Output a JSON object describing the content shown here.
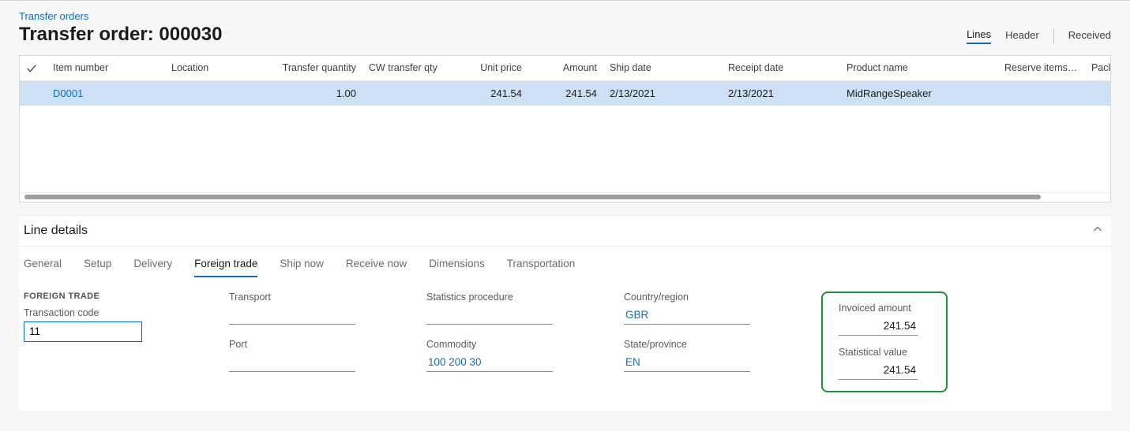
{
  "breadcrumb": {
    "transfer_orders": "Transfer orders"
  },
  "title": "Transfer order: 000030",
  "view_tabs": {
    "lines": "Lines",
    "header": "Header",
    "received": "Received"
  },
  "grid": {
    "columns": {
      "item_number": "Item number",
      "location": "Location",
      "transfer_qty": "Transfer quantity",
      "cw_transfer_qty": "CW transfer qty",
      "unit_price": "Unit price",
      "amount": "Amount",
      "ship_date": "Ship date",
      "receipt_date": "Receipt date",
      "product_name": "Product name",
      "reserve": "Reserve items a...",
      "packing_qty": "Packing qu"
    },
    "rows": [
      {
        "item_number": "D0001",
        "location": "",
        "transfer_qty": "1.00",
        "cw_transfer_qty": "",
        "unit_price": "241.54",
        "amount": "241.54",
        "ship_date": "2/13/2021",
        "receipt_date": "2/13/2021",
        "product_name": "MidRangeSpeaker",
        "reserve": "",
        "packing_qty": ""
      }
    ]
  },
  "line_details": {
    "title": "Line details",
    "tabs": {
      "general": "General",
      "setup": "Setup",
      "delivery": "Delivery",
      "foreign_trade": "Foreign trade",
      "ship_now": "Ship now",
      "receive_now": "Receive now",
      "dimensions": "Dimensions",
      "transportation": "Transportation"
    }
  },
  "foreign_trade": {
    "section_label": "FOREIGN TRADE",
    "labels": {
      "transaction_code": "Transaction code",
      "transport": "Transport",
      "port": "Port",
      "statistics_procedure": "Statistics procedure",
      "commodity": "Commodity",
      "country_region": "Country/region",
      "state_province": "State/province",
      "invoiced_amount": "Invoiced amount",
      "statistical_value": "Statistical value"
    },
    "values": {
      "transaction_code": "11",
      "transport": "",
      "port": "",
      "statistics_procedure": "",
      "commodity": "100 200 30",
      "country_region": "GBR",
      "state_province": "EN",
      "invoiced_amount": "241.54",
      "statistical_value": "241.54"
    }
  }
}
